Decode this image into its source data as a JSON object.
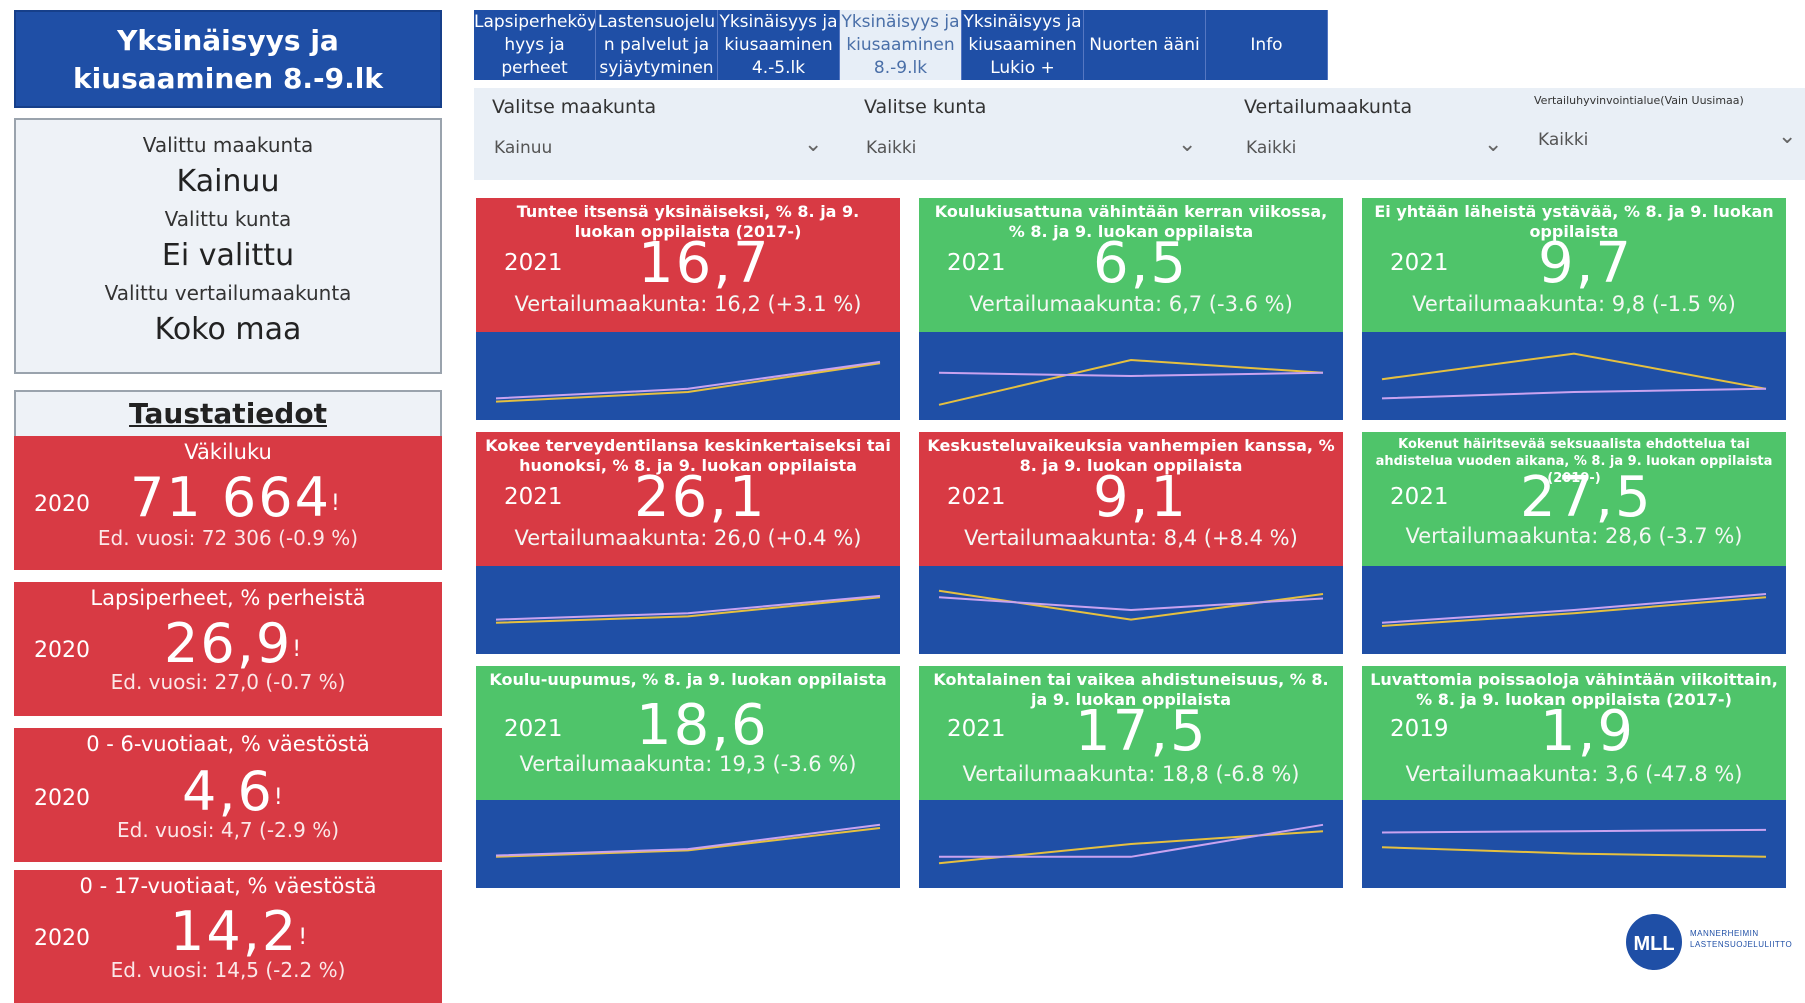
{
  "app_title": "Yksinäisyys ja kiusaaminen 8.-9.lk",
  "selection": {
    "maakunta_label": "Valittu maakunta",
    "maakunta_value": "Kainuu",
    "kunta_label": "Valittu kunta",
    "kunta_value": "Ei valittu",
    "vertailu_label": "Valittu vertailumaakunta",
    "vertailu_value": "Koko maa"
  },
  "background": {
    "header": "Taustatiedot",
    "cards": [
      {
        "label": "Väkiluku",
        "year": "2020",
        "value": "71 664",
        "mark": "!",
        "prev": "Ed. vuosi: 72 306 (-0.9 %)"
      },
      {
        "label": "Lapsiperheet, % perheistä",
        "year": "2020",
        "value": "26,9",
        "mark": "!",
        "prev": "Ed. vuosi: 27,0 (-0.7 %)"
      },
      {
        "label": "0 - 6-vuotiaat, % väestöstä",
        "year": "2020",
        "value": "4,6",
        "mark": "!",
        "prev": "Ed. vuosi: 4,7 (-2.9 %)"
      },
      {
        "label": "0 - 17-vuotiaat, % väestöstä",
        "year": "2020",
        "value": "14,2",
        "mark": "!",
        "prev": "Ed. vuosi: 14,5 (-2.2 %)"
      }
    ]
  },
  "tabs": [
    {
      "label": "Lapsiperheköy hyys ja perheet",
      "active": false
    },
    {
      "label": "Lastensuojelu n palvelut ja syjäytyminen",
      "active": false
    },
    {
      "label": "Yksinäisyys ja kiusaaminen 4.-5.lk",
      "active": false
    },
    {
      "label": "Yksinäisyys ja kiusaaminen 8.-9.lk",
      "active": true
    },
    {
      "label": "Yksinäisyys ja kiusaaminen Lukio +",
      "active": false
    },
    {
      "label": "Nuorten ääni",
      "active": false
    },
    {
      "label": "Info",
      "active": false
    }
  ],
  "filters": [
    {
      "label": "Valitse maakunta",
      "value": "Kainuu"
    },
    {
      "label": "Valitse kunta",
      "value": "Kaikki"
    },
    {
      "label": "Vertailumaakunta",
      "value": "Kaikki"
    },
    {
      "label": "Vertailuhyvinvointialue(Vain Uusimaa)",
      "value": "Kaikki"
    }
  ],
  "kpis": [
    {
      "title": "Tuntee itsensä yksinäiseksi, % 8. ja 9. luokan oppilaista (2017-)",
      "year": "2021",
      "value": "16,7",
      "compare": "Vertailumaakunta: 16,2 (+3.1 %)",
      "color": "red",
      "chart_data": {
        "type": "line",
        "series": [
          {
            "color": "#e5c040",
            "values": [
              0.1,
              0.25,
              0.7
            ]
          },
          {
            "color": "#c9a3f0",
            "values": [
              0.15,
              0.3,
              0.72
            ]
          }
        ]
      }
    },
    {
      "title": "Koulukiusattuna vähintään kerran viikossa, % 8. ja 9. luokan oppilaista",
      "year": "2021",
      "value": "6,5",
      "compare": "Vertailumaakunta: 6,7 (-3.6 %)",
      "color": "green",
      "chart_data": {
        "type": "line",
        "series": [
          {
            "color": "#e5c040",
            "values": [
              0.05,
              0.75,
              0.55
            ]
          },
          {
            "color": "#c9a3f0",
            "values": [
              0.55,
              0.5,
              0.55
            ]
          }
        ]
      }
    },
    {
      "title": "Ei yhtään läheistä ystävää, % 8. ja 9. luokan oppilaista",
      "year": "2021",
      "value": "9,7",
      "compare": "Vertailumaakunta: 9,8 (-1.5 %)",
      "color": "green",
      "chart_data": {
        "type": "line",
        "series": [
          {
            "color": "#e5c040",
            "values": [
              0.45,
              0.85,
              0.3
            ]
          },
          {
            "color": "#c9a3f0",
            "values": [
              0.15,
              0.25,
              0.3
            ]
          }
        ]
      }
    },
    {
      "title": "Kokee terveydentilansa keskinkertaiseksi tai huonoksi, % 8. ja 9. luokan oppilaista",
      "year": "2021",
      "value": "26,1",
      "compare": "Vertailumaakunta: 26,0 (+0.4 %)",
      "color": "red",
      "chart_data": {
        "type": "line",
        "series": [
          {
            "color": "#e5c040",
            "values": [
              0.3,
              0.4,
              0.7
            ]
          },
          {
            "color": "#c9a3f0",
            "values": [
              0.35,
              0.45,
              0.72
            ]
          }
        ]
      }
    },
    {
      "title": "Keskusteluvaikeuksia vanhempien kanssa, % 8. ja 9. luokan oppilaista",
      "year": "2021",
      "value": "9,1",
      "compare": "Vertailumaakunta: 8,4 (+8.4 %)",
      "color": "red",
      "chart_data": {
        "type": "line",
        "series": [
          {
            "color": "#e5c040",
            "values": [
              0.8,
              0.35,
              0.75
            ]
          },
          {
            "color": "#c9a3f0",
            "values": [
              0.7,
              0.5,
              0.68
            ]
          }
        ]
      }
    },
    {
      "title": "Kokenut häiritsevää seksuaalista ehdottelua tai ahdistelua vuoden aikana, % 8. ja 9. luokan oppilaista (2019-)",
      "year": "2021",
      "value": "27,5",
      "compare": "Vertailumaakunta: 28,6 (-3.7 %)",
      "color": "green",
      "chart_data": {
        "type": "line",
        "series": [
          {
            "color": "#e5c040",
            "values": [
              0.25,
              0.45,
              0.7
            ]
          },
          {
            "color": "#c9a3f0",
            "values": [
              0.3,
              0.5,
              0.75
            ]
          }
        ]
      }
    },
    {
      "title": "Koulu-uupumus, % 8. ja 9. luokan oppilaista",
      "year": "2021",
      "value": "18,6",
      "compare": "Vertailumaakunta: 19,3 (-3.6 %)",
      "color": "green",
      "chart_data": {
        "type": "line",
        "series": [
          {
            "color": "#e5c040",
            "values": [
              0.3,
              0.4,
              0.75
            ]
          },
          {
            "color": "#c9a3f0",
            "values": [
              0.32,
              0.42,
              0.8
            ]
          }
        ]
      }
    },
    {
      "title": "Kohtalainen tai vaikea ahdistuneisuus, % 8. ja 9. luokan oppilaista",
      "year": "2021",
      "value": "17,5",
      "compare": "Vertailumaakunta: 18,8 (-6.8 %)",
      "color": "green",
      "chart_data": {
        "type": "line",
        "series": [
          {
            "color": "#e5c040",
            "values": [
              0.2,
              0.5,
              0.7
            ]
          },
          {
            "color": "#c9a3f0",
            "values": [
              0.3,
              0.3,
              0.8
            ]
          }
        ]
      }
    },
    {
      "title": "Luvattomia poissaoloja vähintään viikoittain, % 8. ja 9. luokan oppilaista (2017-)",
      "year": "2019",
      "value": "1,9",
      "compare": "Vertailumaakunta: 3,6 (-47.8 %)",
      "color": "green",
      "chart_data": {
        "type": "line",
        "series": [
          {
            "color": "#e5c040",
            "values": [
              0.45,
              0.35,
              0.3
            ]
          },
          {
            "color": "#c9a3f0",
            "values": [
              0.68,
              0.7,
              0.72
            ]
          }
        ]
      }
    }
  ],
  "logo": {
    "text": "MLL",
    "subtitle": "MANNERHEIMIN LASTENSUOJELULIITTO"
  }
}
